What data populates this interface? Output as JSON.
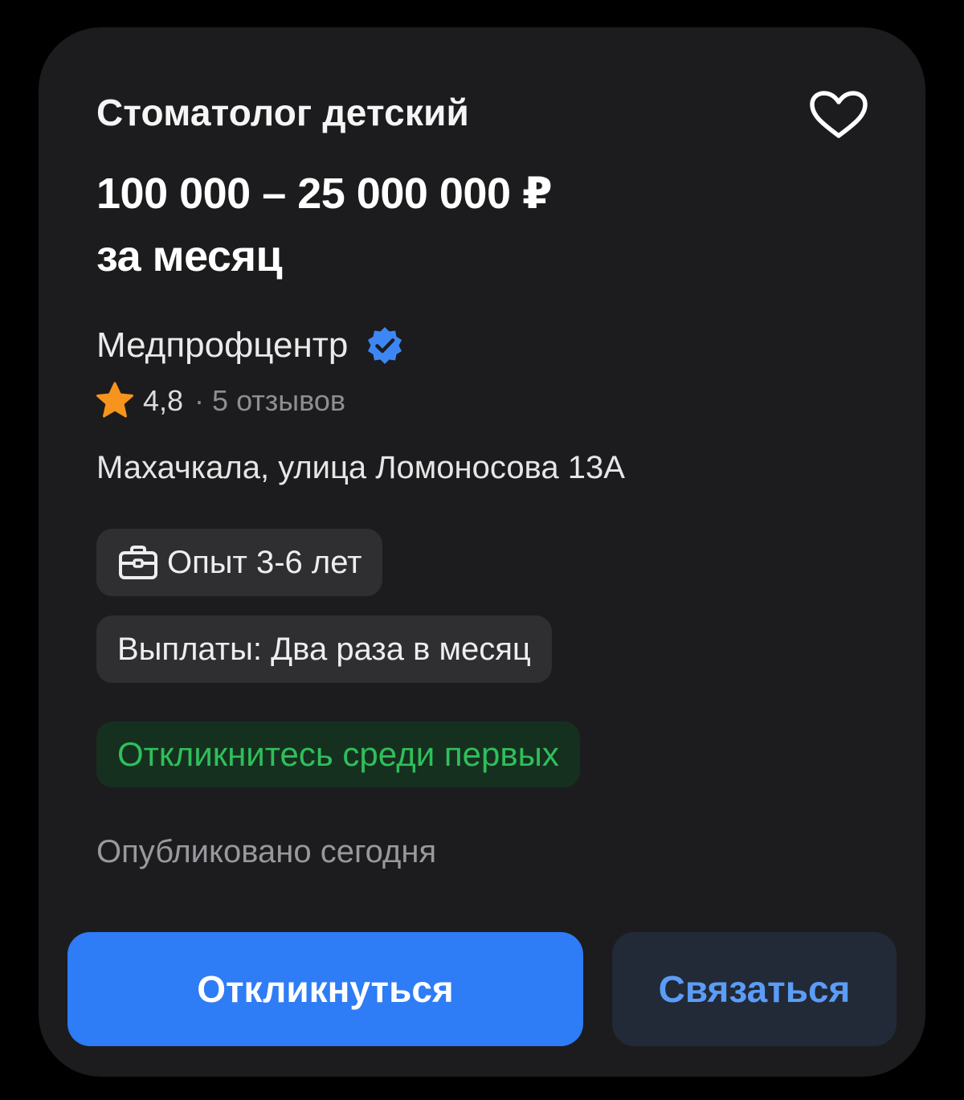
{
  "vacancy": {
    "title": "Стоматолог детский",
    "salary_line1": "100 000 – 25 000 000 ₽",
    "salary_line2": "за месяц"
  },
  "employer": {
    "name": "Медпрофцентр",
    "verified": true,
    "verified_icon": "verified-badge-icon",
    "rating": "4,8",
    "rating_separator": "·",
    "reviews": "5 отзывов"
  },
  "address": "Махачкала, улица Ломоносова 13А",
  "chips": {
    "experience": "Опыт 3-6 лет",
    "payments": "Выплаты: Два раза в месяц",
    "first_responder": "Откликнитесь среди первых"
  },
  "published": "Опубликовано сегодня",
  "actions": {
    "respond_label": "Откликнуться",
    "contact_label": "Связаться"
  },
  "colors": {
    "card_background": "#1c1c1e",
    "primary_button": "#2e7cf6",
    "secondary_button": "#222a38",
    "secondary_button_text": "#5b9cf7",
    "highlight_green": "#2fbf5b",
    "highlight_green_background": "#16301f",
    "star": "#f7941d",
    "verified_badge": "#3d87f5"
  },
  "icons": {
    "favorite": "heart-outline-icon",
    "rating": "star-icon",
    "experience": "briefcase-icon"
  }
}
